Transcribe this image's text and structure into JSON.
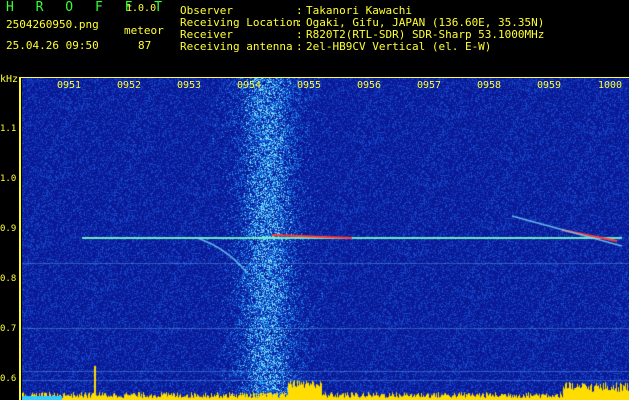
{
  "header": {
    "app_name": "H R O F F T",
    "version": "1.0.0",
    "filename": "2504260950.png",
    "timestamp": "25.04.26 09:50",
    "meteor_label": "meteor",
    "meteor_count": "87"
  },
  "meta": {
    "rows": [
      {
        "key": "Observer",
        "sep": ":",
        "value": "Takanori Kawachi"
      },
      {
        "key": "Receiving Location",
        "sep": ":",
        "value": "Ogaki, Gifu, JAPAN (136.60E, 35.35N)"
      },
      {
        "key": "Receiver",
        "sep": ":",
        "value": "R820T2(RTL-SDR) SDR-Sharp 53.1000MHz"
      },
      {
        "key": "Receiving antenna",
        "sep": ":",
        "value": "2el-HB9CV Vertical (el. E-W)"
      }
    ]
  },
  "axis": {
    "unit": "kHz",
    "x_ticks": [
      "0951",
      "0952",
      "0953",
      "0954",
      "0955",
      "0956",
      "0957",
      "0958",
      "0959",
      "1000"
    ],
    "y_ticks": [
      "1.1",
      "1.0",
      "0.9",
      "0.8",
      "0.7",
      "0.6"
    ]
  },
  "colors": {
    "background": "#0a1a9a",
    "text": "#ffff33",
    "echo": "#ff3b3b",
    "noise": "#33ccff",
    "baseline": "#ffdd00"
  }
}
